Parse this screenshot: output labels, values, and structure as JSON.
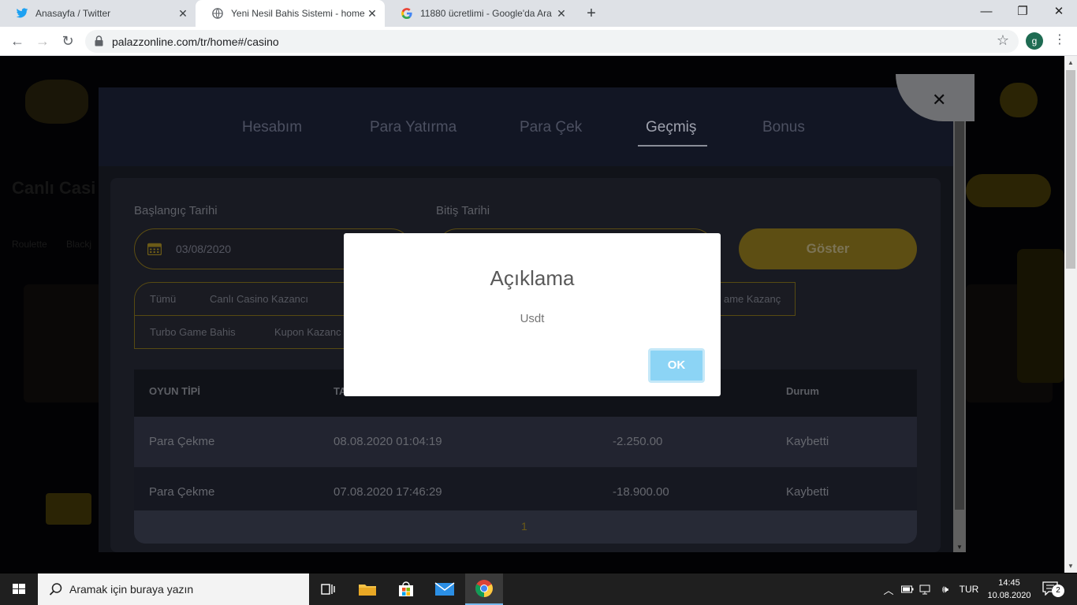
{
  "browser": {
    "tabs": [
      {
        "title": "Anasayfa / Twitter",
        "icon": "twitter-icon"
      },
      {
        "title": "Yeni Nesil Bahis Sistemi - home",
        "icon": "globe-icon"
      },
      {
        "title": "11880 ücretlimi - Google'da Ara",
        "icon": "google-icon"
      }
    ],
    "url": "palazzonline.com/tr/home#/casino",
    "profile_initial": "g"
  },
  "modal": {
    "tabs": [
      "Hesabım",
      "Para Yatırma",
      "Para Çek",
      "Geçmiş",
      "Bonus"
    ],
    "active_tab": "Geçmiş",
    "start_label": "Başlangıç Tarihi",
    "start_value": "03/08/2020",
    "end_label": "Bitiş Tarihi",
    "show_button": "Göster",
    "filters_row1": [
      "Tümü",
      "Canlı Casino Kazancı",
      "ame Kazanç"
    ],
    "filters_row2": [
      "Turbo Game Bahis",
      "Kupon Kazanc"
    ],
    "table": {
      "headers": [
        "OYUN TİPİ",
        "TA",
        "",
        "Durum"
      ],
      "rows": [
        [
          "Para Çekme",
          "08.08.2020 01:04:19",
          "-2.250.00",
          "Kaybetti"
        ],
        [
          "Para Çekme",
          "07.08.2020 17:46:29",
          "-18.900.00",
          "Kaybetti"
        ]
      ]
    },
    "page": "1"
  },
  "background": {
    "heading": "Canlı Casi",
    "filters": [
      "Roulette",
      "Blackj"
    ]
  },
  "alert": {
    "title": "Açıklama",
    "text": "Usdt",
    "ok": "OK"
  },
  "taskbar": {
    "search_placeholder": "Aramak için buraya yazın",
    "lang": "TUR",
    "time": "14:45",
    "date": "10.08.2020",
    "notification_count": "2"
  },
  "colors": {
    "gold": "#5d4e13",
    "ok_button": "#8cd4f5",
    "modal_bg": "#111319"
  }
}
